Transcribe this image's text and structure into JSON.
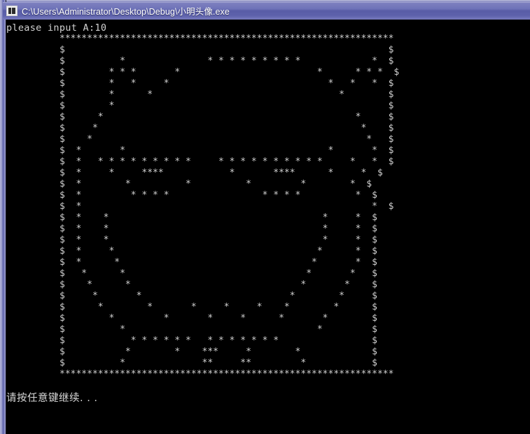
{
  "window": {
    "title": "C:\\Users\\Administrator\\Desktop\\Debug\\小明头像.exe",
    "icon": "console-app-icon",
    "title_bar_color": "#5c60a8",
    "frame_color": "#8f92c6"
  },
  "console": {
    "background_color": "#000000",
    "text_color": "#c8c8c8",
    "prompt": "please input A:10",
    "pause_message": "请按任意键继续. . .",
    "art_border_char": "*",
    "art_side_char": "$",
    "art_fill_char": "*",
    "art_rows": [
      "*************************************************************",
      "$                                                           $",
      "$          *               * * * * * * * * *             *  $",
      "$        * * *       *                         *      * * *  $",
      "$        *   *     *                             *   *   *  $",
      "$        *      *                                  *        $",
      "$        *                                                  $",
      "$      *                                              *     $",
      "$     *                                                *    $",
      "$    *                                                  *   $",
      "$  *       *                                     *       *  $",
      "$  *   * * * * * * * * *     * * * * * * * * * *     *   *  $",
      "$  *     *     ****            *       ****      *     *  $",
      "$  *        *          *          *         *        *  $",
      "$  *         * * * *                 * * * *          *  $",
      "$  *                                                     *  $",
      "$  *    *                                       *     *  $",
      "$  *    *                                       *     *  $",
      "$  *    *                                       *     *  $",
      "$  *     *                                     *      *  $",
      "$  *      *                                   *       *  $",
      "$   *      *                                 *       *   $",
      "$    *      *                               *       *    $",
      "$     *       *                           *        *     $",
      "$      *        *       *     *     *    *        *      $",
      "$        *         *       *     *      *       *        $",
      "$          *                                   *         $",
      "$            * * * * * *   * * * * * * *                 $",
      "$           *        *    ***     *        *             $",
      "$          *              **     **         *            $",
      "*************************************************************"
    ]
  }
}
